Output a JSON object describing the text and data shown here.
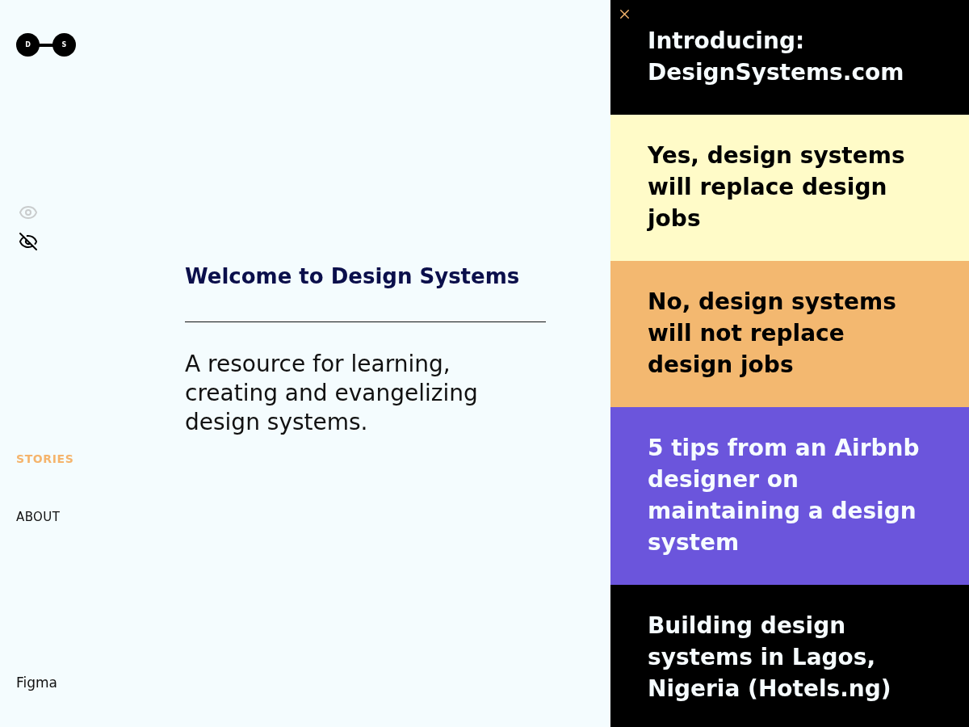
{
  "logo": {
    "letters": [
      "D",
      "S"
    ]
  },
  "view_toggles": [
    {
      "kind": "eye",
      "selected": false
    },
    {
      "kind": "eye-off",
      "selected": true
    }
  ],
  "nav": [
    {
      "label": "STORIES",
      "selected": true
    },
    {
      "label": "ABOUT",
      "selected": false
    }
  ],
  "footer_link": "Figma",
  "intro": {
    "heading": "Welcome to Design Systems",
    "text": "A resource for learning, creating and evangelizing design systems."
  },
  "stories": [
    {
      "title": "Introducing: DesignSystems.com",
      "color": "#000000"
    },
    {
      "title": "Yes, design systems will replace design jobs",
      "color": "#fffbc8"
    },
    {
      "title": "No, design systems will not replace design jobs",
      "color": "#f3b870"
    },
    {
      "title": "5 tips from an Airbnb designer on maintaining a design system",
      "color": "#6b55dc"
    },
    {
      "title": "Building design systems in Lagos, Nigeria (Hotels.ng)",
      "color": "#000000"
    }
  ]
}
